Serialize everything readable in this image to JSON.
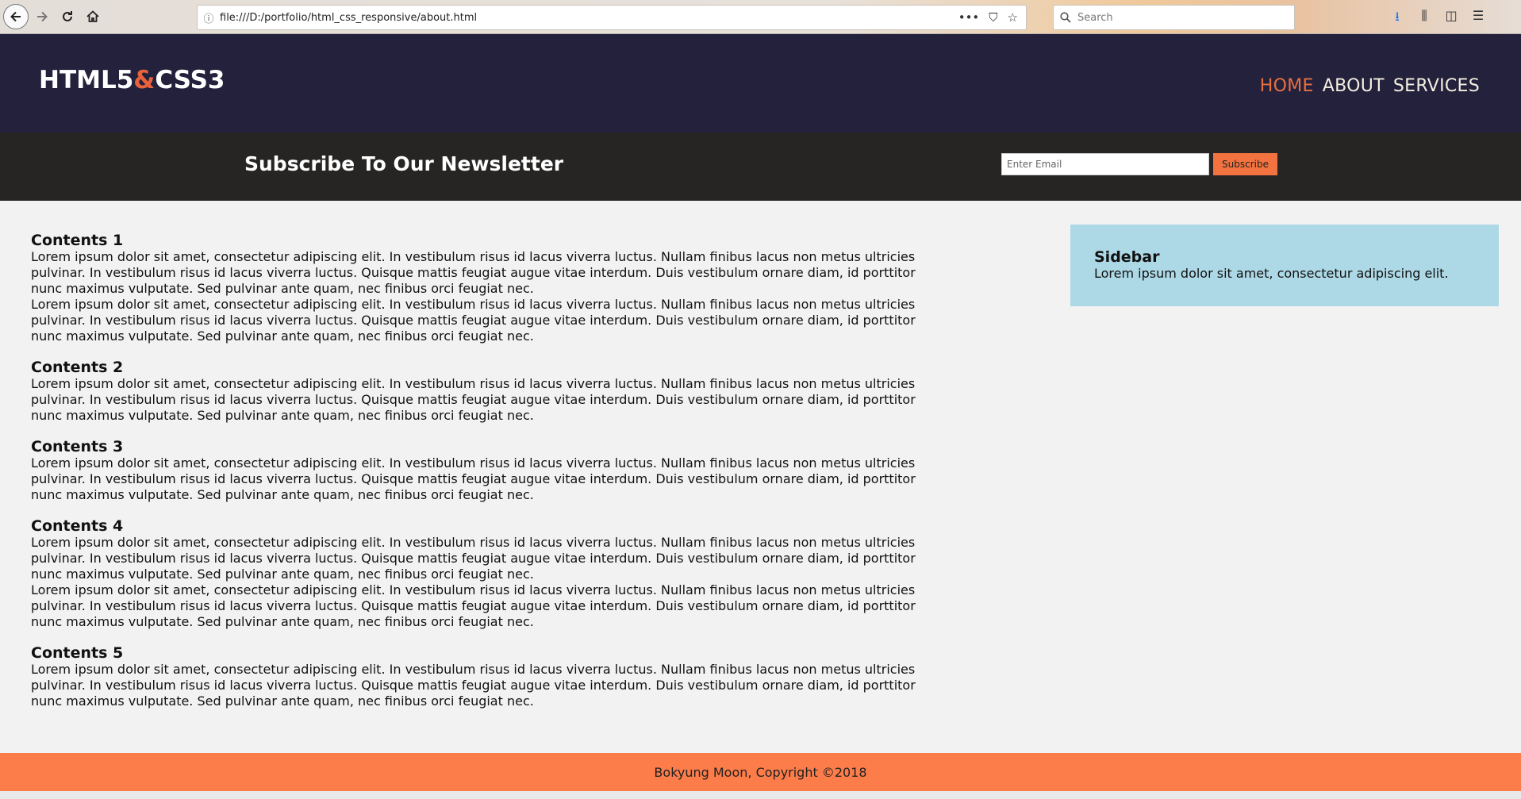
{
  "browser": {
    "url": "file:///D:/portfolio/html_css_responsive/about.html",
    "search_placeholder": "Search",
    "icons": [
      "back-icon",
      "forward-icon",
      "reload-icon",
      "home-icon",
      "info-icon",
      "more-icon",
      "pocket-icon",
      "star-icon",
      "search-icon",
      "download-icon",
      "library-icon",
      "sidebar-icon",
      "menu-icon"
    ]
  },
  "header": {
    "logo_part1": "HTML5",
    "logo_amp": "&",
    "logo_part2": "CSS3",
    "nav": [
      "HOME",
      "ABOUT",
      "SERVICES"
    ],
    "active_nav": "HOME",
    "colors": {
      "bg": "#24213d",
      "accent": "#e8623c",
      "text": "#f3efe0"
    }
  },
  "newsletter": {
    "title": "Subscribe To Our Newsletter",
    "email_placeholder": "Enter Email",
    "button_label": "Subscribe",
    "colors": {
      "bg": "#262524",
      "button": "#f2733f"
    }
  },
  "main": {
    "sections": [
      {
        "title": "Contents 1",
        "paragraphs": [
          "Lorem ipsum dolor sit amet, consectetur adipiscing elit. In vestibulum risus id lacus viverra luctus. Nullam finibus lacus non metus ultricies pulvinar. In vestibulum risus id lacus viverra luctus. Quisque mattis feugiat augue vitae interdum. Duis vestibulum ornare diam, id porttitor nunc maximus vulputate. Sed pulvinar ante quam, nec finibus orci feugiat nec.",
          "Lorem ipsum dolor sit amet, consectetur adipiscing elit. In vestibulum risus id lacus viverra luctus. Nullam finibus lacus non metus ultricies pulvinar. In vestibulum risus id lacus viverra luctus. Quisque mattis feugiat augue vitae interdum. Duis vestibulum ornare diam, id porttitor nunc maximus vulputate. Sed pulvinar ante quam, nec finibus orci feugiat nec."
        ]
      },
      {
        "title": "Contents 2",
        "paragraphs": [
          "Lorem ipsum dolor sit amet, consectetur adipiscing elit. In vestibulum risus id lacus viverra luctus. Nullam finibus lacus non metus ultricies pulvinar. In vestibulum risus id lacus viverra luctus. Quisque mattis feugiat augue vitae interdum. Duis vestibulum ornare diam, id porttitor nunc maximus vulputate. Sed pulvinar ante quam, nec finibus orci feugiat nec."
        ]
      },
      {
        "title": "Contents 3",
        "paragraphs": [
          "Lorem ipsum dolor sit amet, consectetur adipiscing elit. In vestibulum risus id lacus viverra luctus. Nullam finibus lacus non metus ultricies pulvinar. In vestibulum risus id lacus viverra luctus. Quisque mattis feugiat augue vitae interdum. Duis vestibulum ornare diam, id porttitor nunc maximus vulputate. Sed pulvinar ante quam, nec finibus orci feugiat nec."
        ]
      },
      {
        "title": "Contents 4",
        "paragraphs": [
          "Lorem ipsum dolor sit amet, consectetur adipiscing elit. In vestibulum risus id lacus viverra luctus. Nullam finibus lacus non metus ultricies pulvinar. In vestibulum risus id lacus viverra luctus. Quisque mattis feugiat augue vitae interdum. Duis vestibulum ornare diam, id porttitor nunc maximus vulputate. Sed pulvinar ante quam, nec finibus orci feugiat nec.",
          "Lorem ipsum dolor sit amet, consectetur adipiscing elit. In vestibulum risus id lacus viverra luctus. Nullam finibus lacus non metus ultricies pulvinar. In vestibulum risus id lacus viverra luctus. Quisque mattis feugiat augue vitae interdum. Duis vestibulum ornare diam, id porttitor nunc maximus vulputate. Sed pulvinar ante quam, nec finibus orci feugiat nec."
        ]
      },
      {
        "title": "Contents 5",
        "paragraphs": [
          "Lorem ipsum dolor sit amet, consectetur adipiscing elit. In vestibulum risus id lacus viverra luctus. Nullam finibus lacus non metus ultricies pulvinar. In vestibulum risus id lacus viverra luctus. Quisque mattis feugiat augue vitae interdum. Duis vestibulum ornare diam, id porttitor nunc maximus vulputate. Sed pulvinar ante quam, nec finibus orci feugiat nec."
        ]
      }
    ]
  },
  "sidebar": {
    "title": "Sidebar",
    "text": "Lorem ipsum dolor sit amet, consectetur adipiscing elit.",
    "colors": {
      "bg": "#add8e6"
    }
  },
  "footer": {
    "text": "Bokyung Moon, Copyright ©2018",
    "colors": {
      "bg": "#fd7d4a"
    }
  }
}
